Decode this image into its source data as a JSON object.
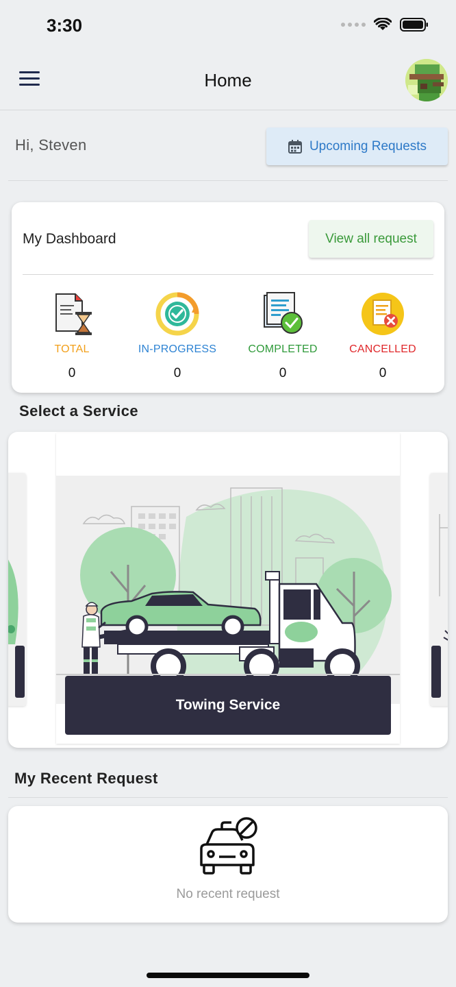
{
  "status_bar": {
    "time": "3:30"
  },
  "header": {
    "title": "Home",
    "avatar_icon": "user-avatar"
  },
  "greeting": "Hi, Steven",
  "upcoming_button": {
    "label": "Upcoming Requests",
    "icon": "calendar-icon"
  },
  "dashboard": {
    "title": "My Dashboard",
    "view_all_label": "View all request",
    "stats": [
      {
        "label": "TOTAL",
        "value": "0",
        "color": "#f2a01b",
        "icon": "document-hourglass-icon"
      },
      {
        "label": "IN-PROGRESS",
        "value": "0",
        "color": "#2d83d3",
        "icon": "progress-check-icon"
      },
      {
        "label": "COMPLETED",
        "value": "0",
        "color": "#2f9a3a",
        "icon": "document-check-icon"
      },
      {
        "label": "CANCELLED",
        "value": "0",
        "color": "#e0282b",
        "icon": "document-cancel-icon"
      }
    ]
  },
  "services": {
    "title": "Select a Service",
    "items": [
      {
        "label": "Towing Service",
        "icon": "tow-truck-illustration"
      }
    ]
  },
  "recent": {
    "title": "My Recent Request",
    "empty_text": "No recent request",
    "empty_icon": "car-blocked-icon"
  },
  "colors": {
    "accent_blue": "#2d79c7",
    "accent_green": "#3a9a3a",
    "dark": "#2f2e41",
    "illustration_green": "#8ed19b"
  }
}
